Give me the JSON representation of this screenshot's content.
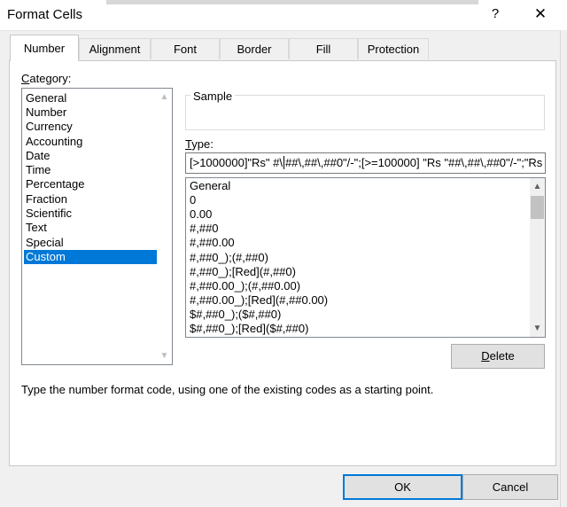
{
  "window": {
    "title": "Format Cells",
    "help_glyph": "?",
    "close_glyph": "✕"
  },
  "tabs": [
    {
      "label": "Number",
      "active": true
    },
    {
      "label": "Alignment",
      "active": false
    },
    {
      "label": "Font",
      "active": false
    },
    {
      "label": "Border",
      "active": false
    },
    {
      "label": "Fill",
      "active": false
    },
    {
      "label": "Protection",
      "active": false
    }
  ],
  "category": {
    "label_first": "C",
    "label_rest": "ategory:",
    "items": [
      "General",
      "Number",
      "Currency",
      "Accounting",
      "Date",
      "Time",
      "Percentage",
      "Fraction",
      "Scientific",
      "Text",
      "Special",
      "Custom"
    ],
    "selected": "Custom"
  },
  "sample": {
    "label": "Sample",
    "value": ""
  },
  "type": {
    "label_first": "T",
    "label_rest": "ype:",
    "value_before_caret": "[>1000000]\"Rs\" #\\",
    "value_after_caret": "##\\,##\\,##0\"/-\";[>=100000] \"Rs \"##\\,##\\,##0\"/-\";\"Rs"
  },
  "format_list": {
    "items": [
      "General",
      "0",
      "0.00",
      "#,##0",
      "#,##0.00",
      "#,##0_);(#,##0)",
      "#,##0_);[Red](#,##0)",
      "#,##0.00_);(#,##0.00)",
      "#,##0.00_);[Red](#,##0.00)",
      "$#,##0_);($#,##0)",
      "$#,##0_);[Red]($#,##0)"
    ]
  },
  "buttons": {
    "delete_first": "D",
    "delete_rest": "elete",
    "ok": "OK",
    "cancel": "Cancel"
  },
  "help_text": "Type the number format code, using one of the existing codes as a starting point.",
  "icons": {
    "scroll_up": "▲",
    "scroll_down": "▼"
  }
}
